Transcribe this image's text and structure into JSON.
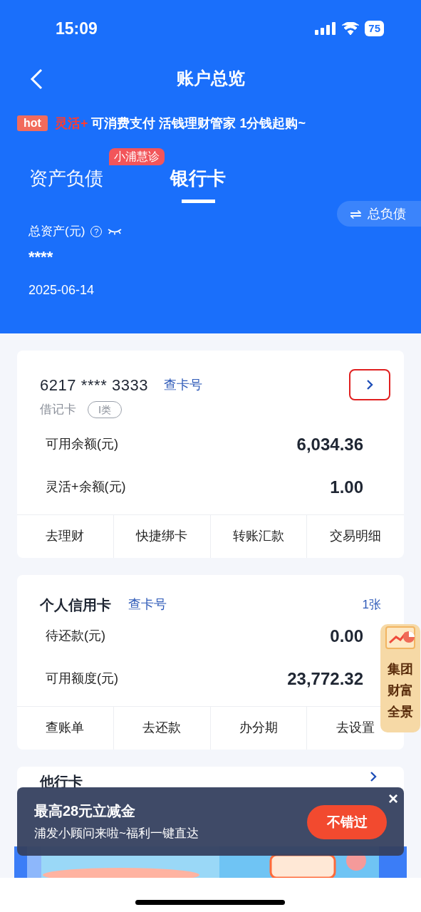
{
  "status_bar": {
    "time": "15:09",
    "battery": "75"
  },
  "nav": {
    "title": "账户总览"
  },
  "promo": {
    "badge": "hot",
    "highlight": "灵活+",
    "text": "可消费支付 活钱理财管家 1分钱起购~"
  },
  "tabs": [
    {
      "label": "资产负债",
      "selected": false,
      "badge": "小浦慧诊"
    },
    {
      "label": "银行卡",
      "selected": true
    }
  ],
  "switch_button": {
    "icon": "⇌",
    "label": "总负债"
  },
  "summary": {
    "label": "总资产(元)",
    "help": "?",
    "value": "****",
    "date": "2025-06-14"
  },
  "debit_card": {
    "number": "6217 **** 3333",
    "link": "查卡号",
    "type": "借记卡",
    "tag": "Ⅰ类",
    "highlighted": true,
    "rows": [
      {
        "label": "可用余额(元)",
        "value": "6,034.36"
      },
      {
        "label": "灵活+余额(元)",
        "value": "1.00"
      }
    ],
    "actions": [
      "去理财",
      "快捷绑卡",
      "转账汇款",
      "交易明细"
    ]
  },
  "credit_card": {
    "title": "个人信用卡",
    "link": "查卡号",
    "count": "1张",
    "rows": [
      {
        "label": "待还款(元)",
        "value": "0.00"
      },
      {
        "label": "可用额度(元)",
        "value": "23,772.32"
      }
    ],
    "actions": [
      "查账单",
      "去还款",
      "办分期",
      "去设置"
    ]
  },
  "other_card": {
    "title": "他行卡"
  },
  "floating_widget": {
    "lines": [
      "集团",
      "财富",
      "全景"
    ]
  },
  "popup": {
    "title": "最高28元立减金",
    "subtitle": "浦发小顾问来啦~福利一键直达",
    "button": "不错过",
    "close": "×"
  }
}
